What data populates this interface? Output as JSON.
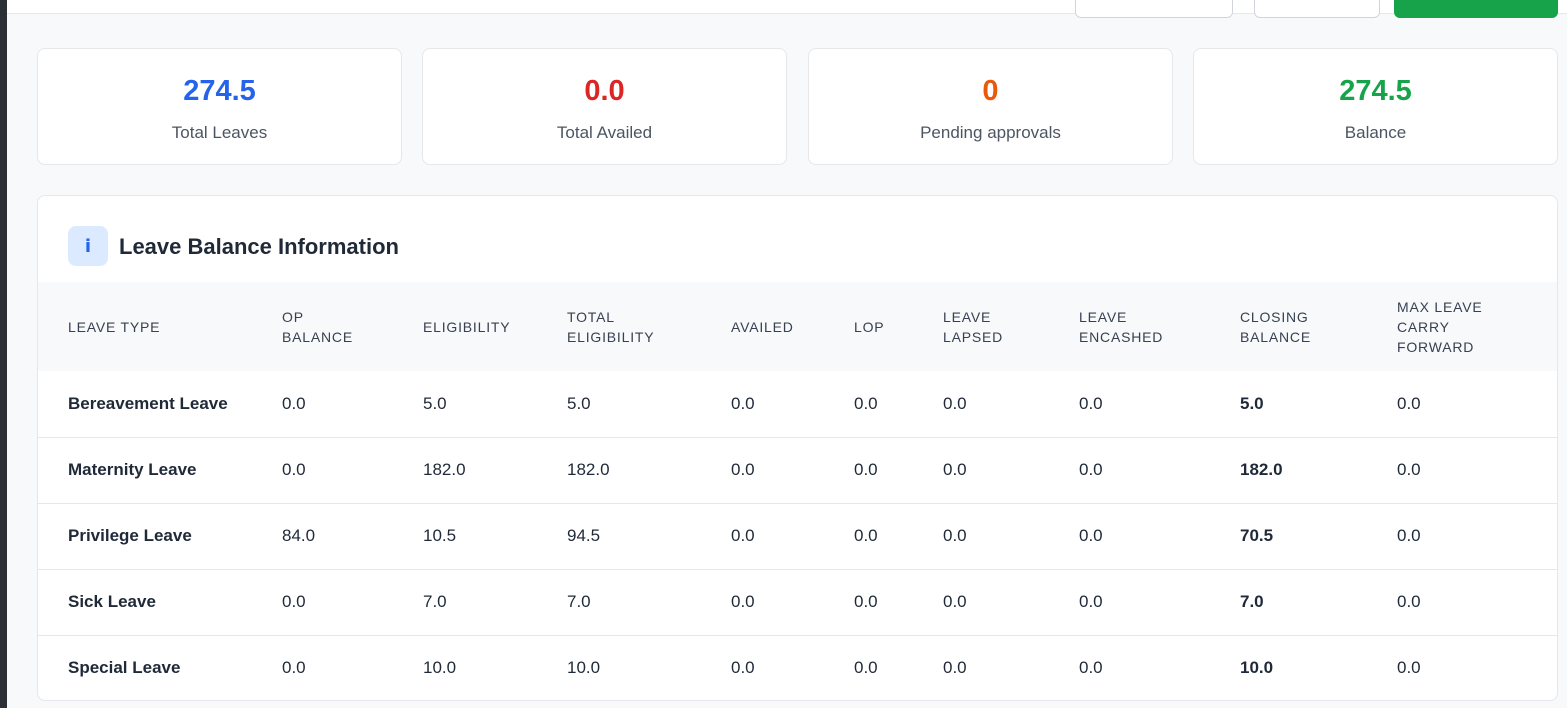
{
  "summary": [
    {
      "value": "274.5",
      "label": "Total Leaves",
      "color": "#2563eb"
    },
    {
      "value": "0.0",
      "label": "Total Availed",
      "color": "#dc2626"
    },
    {
      "value": "0",
      "label": "Pending approvals",
      "color": "#ea580c"
    },
    {
      "value": "274.5",
      "label": "Balance",
      "color": "#16a34a"
    }
  ],
  "panel": {
    "icon": "i",
    "title": "Leave Balance Information"
  },
  "table": {
    "headers": [
      [
        "LEAVE TYPE"
      ],
      [
        "OP",
        "BALANCE"
      ],
      [
        "ELIGIBILITY"
      ],
      [
        "TOTAL",
        "ELIGIBILITY"
      ],
      [
        "AVAILED"
      ],
      [
        "LOP"
      ],
      [
        "LEAVE",
        "LAPSED"
      ],
      [
        "LEAVE",
        "ENCASHED"
      ],
      [
        "CLOSING",
        "BALANCE"
      ],
      [
        "MAX LEAVE",
        "CARRY",
        "FORWARD"
      ]
    ],
    "rows": [
      [
        "Bereavement Leave",
        "0.0",
        "5.0",
        "5.0",
        "0.0",
        "0.0",
        "0.0",
        "0.0",
        "5.0",
        "0.0"
      ],
      [
        "Maternity Leave",
        "0.0",
        "182.0",
        "182.0",
        "0.0",
        "0.0",
        "0.0",
        "0.0",
        "182.0",
        "0.0"
      ],
      [
        "Privilege Leave",
        "84.0",
        "10.5",
        "94.5",
        "0.0",
        "0.0",
        "0.0",
        "0.0",
        "70.5",
        "0.0"
      ],
      [
        "Sick Leave",
        "0.0",
        "7.0",
        "7.0",
        "0.0",
        "0.0",
        "0.0",
        "0.0",
        "7.0",
        "0.0"
      ],
      [
        "Special Leave",
        "0.0",
        "10.0",
        "10.0",
        "0.0",
        "0.0",
        "0.0",
        "0.0",
        "10.0",
        "0.0"
      ]
    ]
  }
}
